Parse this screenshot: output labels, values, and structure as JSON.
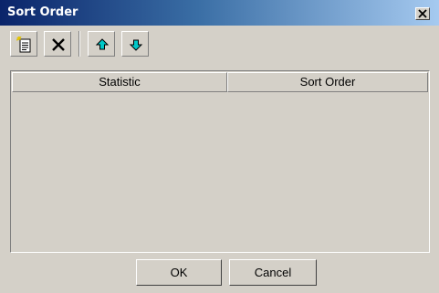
{
  "window": {
    "title": "Sort Order"
  },
  "titlebar": {
    "close_label": "X"
  },
  "toolbar": {
    "buttons": [
      {
        "name": "new-button",
        "icon": "new-document-icon"
      },
      {
        "name": "delete-button",
        "icon": "delete-x-icon"
      },
      {
        "name": "move-up-button",
        "icon": "arrow-up-icon"
      },
      {
        "name": "move-down-button",
        "icon": "arrow-down-icon"
      }
    ]
  },
  "table": {
    "columns": [
      "Statistic",
      "Sort Order"
    ],
    "rows": []
  },
  "footer": {
    "ok_label": "OK",
    "cancel_label": "Cancel"
  },
  "colors": {
    "title_start": "#0a246a",
    "title_end": "#a6caf0",
    "face": "#d4d0c8",
    "arrow": "#00a0a0"
  }
}
